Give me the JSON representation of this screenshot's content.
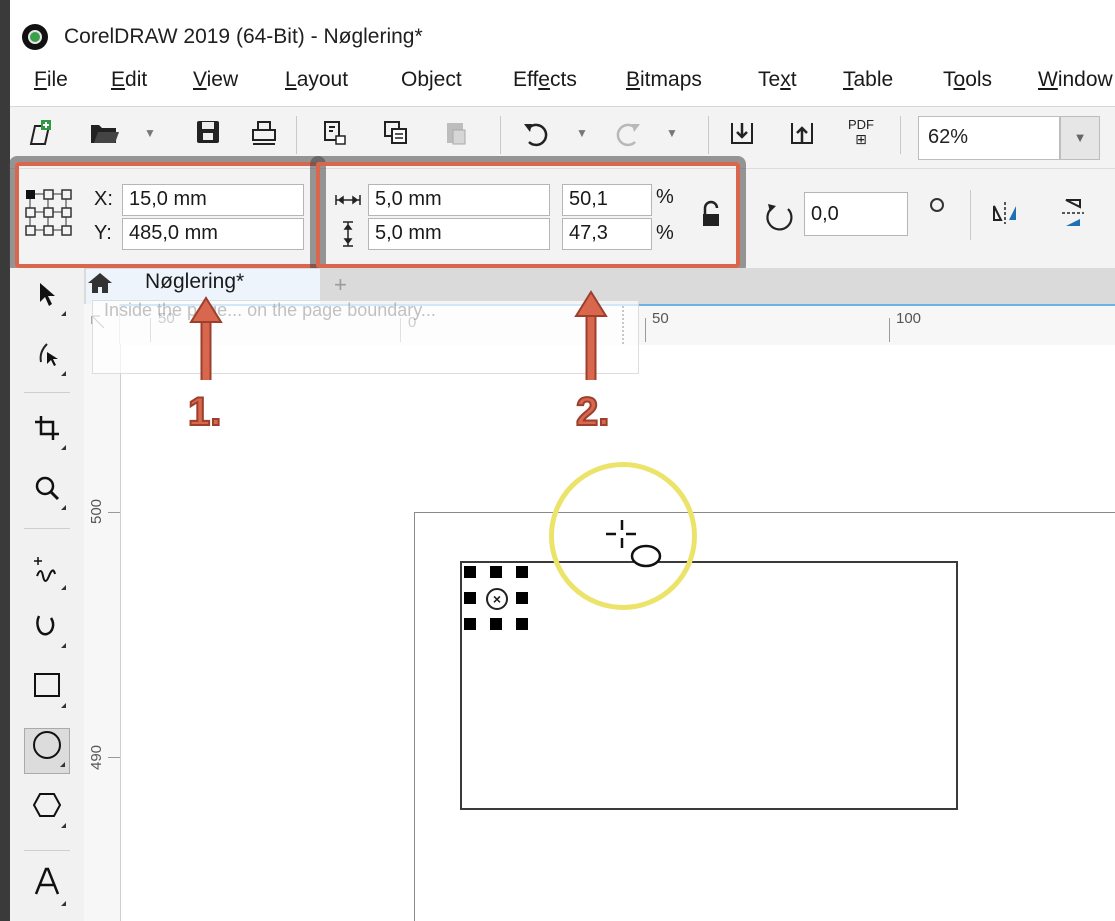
{
  "window": {
    "title": "CorelDRAW 2019 (64-Bit) - Nøglering*"
  },
  "menu": [
    {
      "label": "File",
      "u": "F",
      "rest": "ile"
    },
    {
      "label": "Edit",
      "u": "E",
      "rest": "dit"
    },
    {
      "label": "View",
      "u": "V",
      "rest": "iew"
    },
    {
      "label": "Layout",
      "u": "L",
      "rest": "ayout"
    },
    {
      "label": "Object",
      "u": "",
      "rest": "Object"
    },
    {
      "label": "Effects",
      "pre": "Eff",
      "u": "e",
      "rest": "cts"
    },
    {
      "label": "Bitmaps",
      "u": "B",
      "rest": "itmaps"
    },
    {
      "label": "Text",
      "pre": "Te",
      "u": "x",
      "rest": "t"
    },
    {
      "label": "Table",
      "u": "T",
      "rest": "able"
    },
    {
      "label": "Tools",
      "pre": "T",
      "u": "o",
      "rest": "ols"
    },
    {
      "label": "Window",
      "u": "W",
      "rest": "indow"
    }
  ],
  "toolbar": {
    "zoom_value": "62%",
    "pdf_label": "PDF"
  },
  "properties": {
    "x_label": "X:",
    "x_value": "15,0 mm",
    "y_label": "Y:",
    "y_value": "485,0 mm",
    "width_value": "5,0 mm",
    "height_value": "5,0 mm",
    "scale_x": "50,1",
    "scale_y": "47,3",
    "percent": "%",
    "rotation": "0,0"
  },
  "document": {
    "tab_label": "Nøglering*",
    "new_tab": "+"
  },
  "ruler": {
    "h_labels": [
      "50",
      "0",
      "50",
      "100"
    ],
    "v_labels": [
      "500",
      "490"
    ]
  },
  "ghost_tooltip": "Inside the page... on the page boundary...",
  "annotations": {
    "one": "1.",
    "two": "2."
  },
  "colors": {
    "annotation": "#d9674e",
    "cursor_highlight": "#ece46a",
    "ruler_accent": "#6fb0e4"
  }
}
